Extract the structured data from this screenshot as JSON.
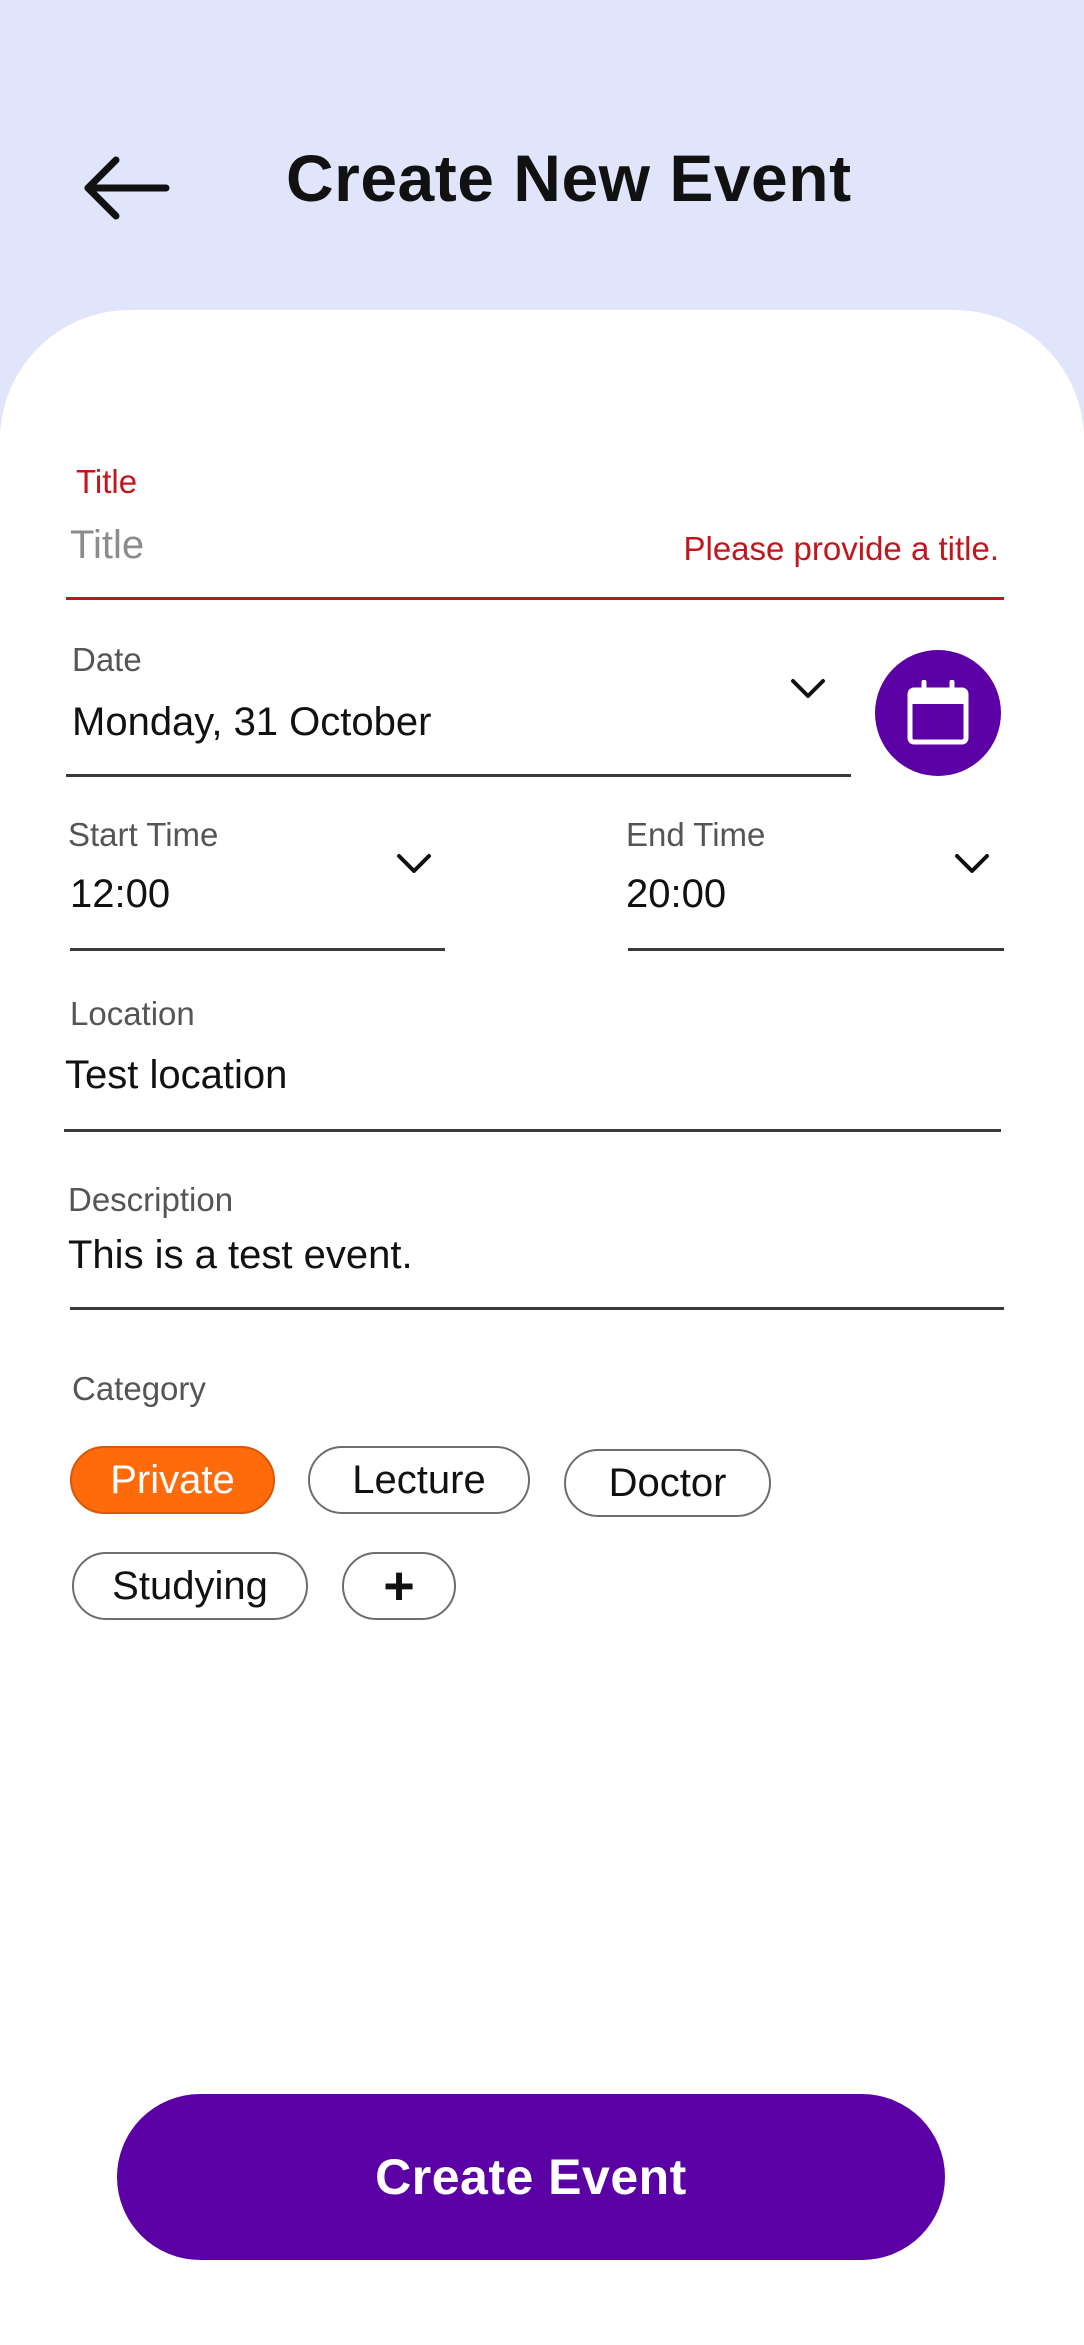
{
  "header": {
    "title": "Create New Event",
    "back_icon": "arrow-left-icon"
  },
  "form": {
    "title_field": {
      "label": "Title",
      "placeholder": "Title",
      "value": "",
      "error": "Please provide a title.",
      "error_color": "#c0161c"
    },
    "date_field": {
      "label": "Date",
      "value": "Monday, 31 October",
      "calendar_icon": "calendar-icon"
    },
    "start_time": {
      "label": "Start Time",
      "value": "12:00"
    },
    "end_time": {
      "label": "End Time",
      "value": "20:00"
    },
    "location": {
      "label": "Location",
      "value": "Test location"
    },
    "description": {
      "label": "Description",
      "value": "This is a test event."
    },
    "category": {
      "label": "Category",
      "chips": [
        {
          "label": "Private",
          "selected": true
        },
        {
          "label": "Lecture",
          "selected": false
        },
        {
          "label": "Doctor",
          "selected": false
        },
        {
          "label": "Studying",
          "selected": false
        }
      ],
      "add_label": "+"
    }
  },
  "actions": {
    "create_label": "Create Event"
  },
  "colors": {
    "header_bg": "#e1e5fb",
    "accent_purple": "#5b00a5",
    "selected_chip": "#ff6a0a",
    "error": "#c0161c"
  }
}
